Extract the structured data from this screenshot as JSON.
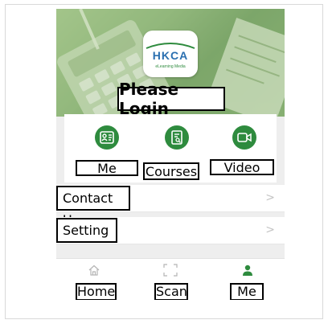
{
  "header": {
    "logo_text": "HKCA",
    "logo_subtext": "eLearning Media",
    "login_label": "Please Login"
  },
  "quick_menu": [
    {
      "label": "Me",
      "icon": "contact-card-icon"
    },
    {
      "label": "Courses",
      "icon": "course-document-icon"
    },
    {
      "label": "Video",
      "icon": "video-camera-icon"
    }
  ],
  "list": [
    {
      "label": "Contact Us",
      "chevron": ">"
    },
    {
      "label": "Setting",
      "chevron": ">"
    }
  ],
  "tabs": [
    {
      "label": "Home",
      "icon": "home-icon",
      "active": false
    },
    {
      "label": "Scan",
      "icon": "scan-icon",
      "active": false
    },
    {
      "label": "Me",
      "icon": "person-icon",
      "active": true
    }
  ],
  "colors": {
    "accent": "#2e8b3e",
    "header_tint": "#8fb57a",
    "background": "#eeeeee",
    "inactive_icon": "#b5b5b5"
  }
}
